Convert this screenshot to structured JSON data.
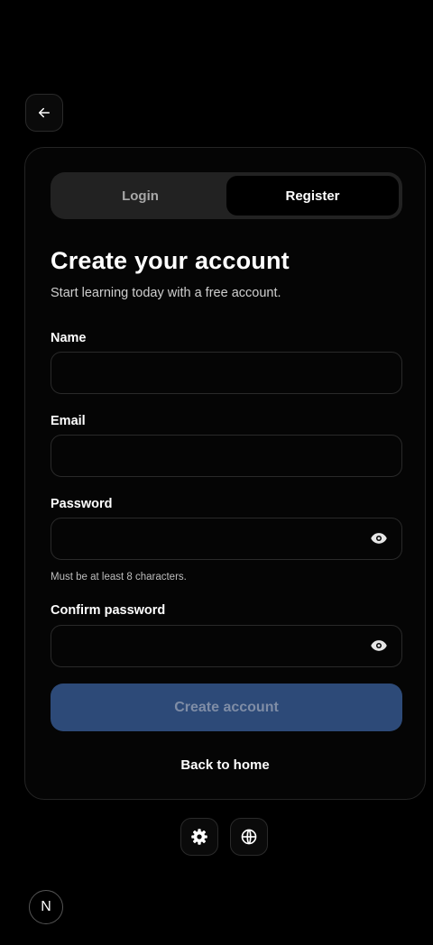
{
  "nav": {
    "back_icon": "arrow-left-icon"
  },
  "auth": {
    "tabs": [
      {
        "label": "Login",
        "active": false
      },
      {
        "label": "Register",
        "active": true
      }
    ],
    "heading": "Create your account",
    "subheading": "Start learning today with a free account.",
    "fields": {
      "name": {
        "label": "Name",
        "value": ""
      },
      "email": {
        "label": "Email",
        "value": ""
      },
      "password": {
        "label": "Password",
        "value": "",
        "hint": "Must be at least 8 characters.",
        "toggle_icon": "eye-icon"
      },
      "confirm": {
        "label": "Confirm password",
        "value": "",
        "toggle_icon": "eye-icon"
      }
    },
    "submit_label": "Create account",
    "back_home_label": "Back to home"
  },
  "footer": {
    "settings_icon": "gear-icon",
    "language_icon": "globe-icon",
    "badge_letter": "N"
  },
  "colors": {
    "background": "#000000",
    "submit_bg": "#2d4a78",
    "submit_text": "#7f8da6"
  }
}
